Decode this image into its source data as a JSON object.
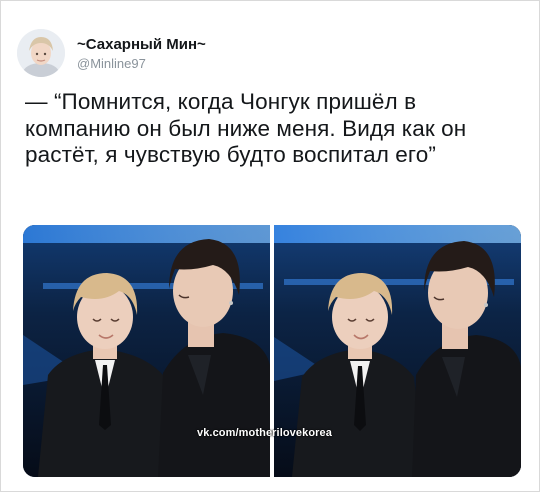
{
  "tweet": {
    "display_name": "~Сахарный Мин~",
    "handle": "@Minline97",
    "text": "— “Помнится, когда Чонгук пришёл в компанию он был ниже меня. Видя как он растёт, я чувствую будто воспитал его”",
    "media": {
      "photo_count": 2,
      "watermark": "vk.com/motherilovekorea"
    }
  },
  "icons": {
    "avatar": "profile-avatar"
  },
  "colors": {
    "text": "#14171a",
    "secondary_text": "#8a939b",
    "stage_light": "#2f7fe0",
    "stage_dark": "#0b1a30",
    "suit": "#17191d"
  }
}
